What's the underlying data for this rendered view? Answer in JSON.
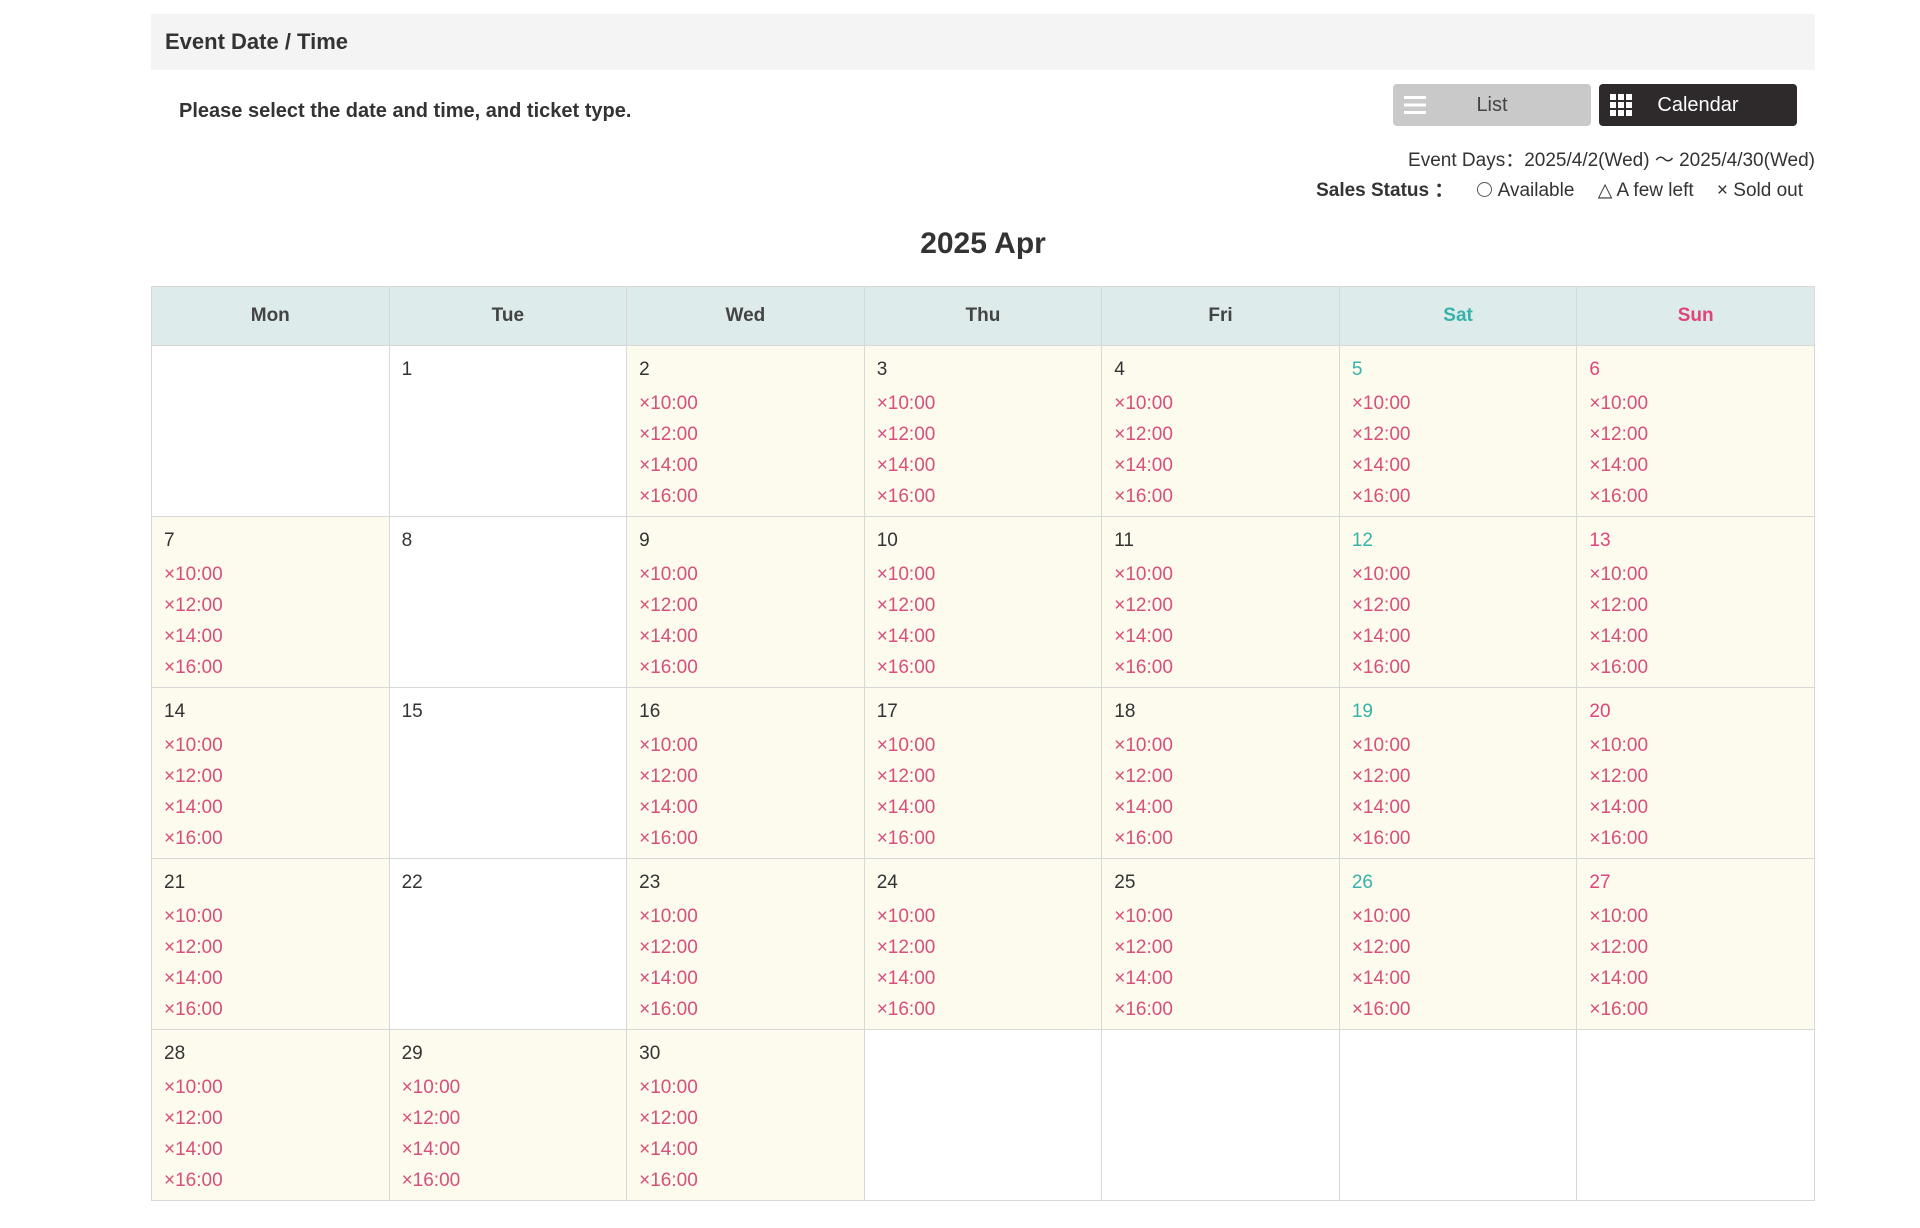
{
  "section_title": "Event Date / Time",
  "instruction": "Please select the date and time, and ticket type.",
  "view_toggle": {
    "list_label": "List",
    "calendar_label": "Calendar"
  },
  "event_days": "Event Days：2025/4/2(Wed) 〜 2025/4/30(Wed)",
  "sales_status": {
    "label": "Sales Status ：",
    "available": "Available",
    "few_left": "△ A few left",
    "sold_out": "× Sold out"
  },
  "month_title": "2025 Apr",
  "colors": {
    "sat": "#36b3a8",
    "sun": "#e0447a",
    "slot": "#d6507c"
  },
  "weekdays": [
    "Mon",
    "Tue",
    "Wed",
    "Thu",
    "Fri",
    "Sat",
    "Sun"
  ],
  "weeks": [
    [
      {
        "day": "",
        "slots": []
      },
      {
        "day": "1",
        "slots": []
      },
      {
        "day": "2",
        "slots": [
          "×10:00",
          "×12:00",
          "×14:00",
          "×16:00"
        ]
      },
      {
        "day": "3",
        "slots": [
          "×10:00",
          "×12:00",
          "×14:00",
          "×16:00"
        ]
      },
      {
        "day": "4",
        "slots": [
          "×10:00",
          "×12:00",
          "×14:00",
          "×16:00"
        ]
      },
      {
        "day": "5",
        "slots": [
          "×10:00",
          "×12:00",
          "×14:00",
          "×16:00"
        ]
      },
      {
        "day": "6",
        "slots": [
          "×10:00",
          "×12:00",
          "×14:00",
          "×16:00"
        ]
      }
    ],
    [
      {
        "day": "7",
        "slots": [
          "×10:00",
          "×12:00",
          "×14:00",
          "×16:00"
        ]
      },
      {
        "day": "8",
        "slots": []
      },
      {
        "day": "9",
        "slots": [
          "×10:00",
          "×12:00",
          "×14:00",
          "×16:00"
        ]
      },
      {
        "day": "10",
        "slots": [
          "×10:00",
          "×12:00",
          "×14:00",
          "×16:00"
        ]
      },
      {
        "day": "11",
        "slots": [
          "×10:00",
          "×12:00",
          "×14:00",
          "×16:00"
        ]
      },
      {
        "day": "12",
        "slots": [
          "×10:00",
          "×12:00",
          "×14:00",
          "×16:00"
        ]
      },
      {
        "day": "13",
        "slots": [
          "×10:00",
          "×12:00",
          "×14:00",
          "×16:00"
        ]
      }
    ],
    [
      {
        "day": "14",
        "slots": [
          "×10:00",
          "×12:00",
          "×14:00",
          "×16:00"
        ]
      },
      {
        "day": "15",
        "slots": []
      },
      {
        "day": "16",
        "slots": [
          "×10:00",
          "×12:00",
          "×14:00",
          "×16:00"
        ]
      },
      {
        "day": "17",
        "slots": [
          "×10:00",
          "×12:00",
          "×14:00",
          "×16:00"
        ]
      },
      {
        "day": "18",
        "slots": [
          "×10:00",
          "×12:00",
          "×14:00",
          "×16:00"
        ]
      },
      {
        "day": "19",
        "slots": [
          "×10:00",
          "×12:00",
          "×14:00",
          "×16:00"
        ]
      },
      {
        "day": "20",
        "slots": [
          "×10:00",
          "×12:00",
          "×14:00",
          "×16:00"
        ]
      }
    ],
    [
      {
        "day": "21",
        "slots": [
          "×10:00",
          "×12:00",
          "×14:00",
          "×16:00"
        ]
      },
      {
        "day": "22",
        "slots": []
      },
      {
        "day": "23",
        "slots": [
          "×10:00",
          "×12:00",
          "×14:00",
          "×16:00"
        ]
      },
      {
        "day": "24",
        "slots": [
          "×10:00",
          "×12:00",
          "×14:00",
          "×16:00"
        ]
      },
      {
        "day": "25",
        "slots": [
          "×10:00",
          "×12:00",
          "×14:00",
          "×16:00"
        ]
      },
      {
        "day": "26",
        "slots": [
          "×10:00",
          "×12:00",
          "×14:00",
          "×16:00"
        ]
      },
      {
        "day": "27",
        "slots": [
          "×10:00",
          "×12:00",
          "×14:00",
          "×16:00"
        ]
      }
    ],
    [
      {
        "day": "28",
        "slots": [
          "×10:00",
          "×12:00",
          "×14:00",
          "×16:00"
        ]
      },
      {
        "day": "29",
        "slots": [
          "×10:00",
          "×12:00",
          "×14:00",
          "×16:00"
        ]
      },
      {
        "day": "30",
        "slots": [
          "×10:00",
          "×12:00",
          "×14:00",
          "×16:00"
        ]
      },
      {
        "day": "",
        "slots": []
      },
      {
        "day": "",
        "slots": []
      },
      {
        "day": "",
        "slots": []
      },
      {
        "day": "",
        "slots": []
      }
    ]
  ]
}
